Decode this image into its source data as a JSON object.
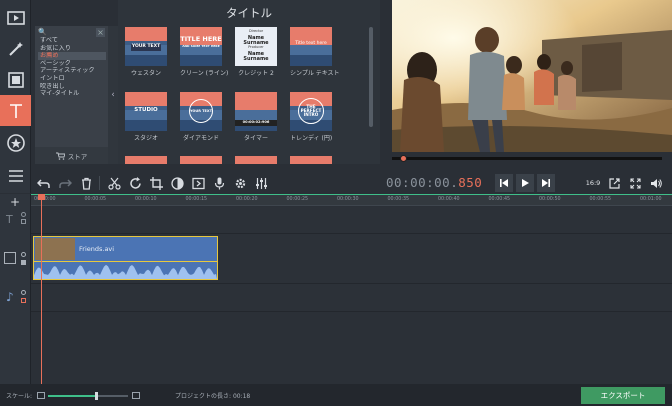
{
  "app": {
    "panel_title": "タイトル"
  },
  "categories": {
    "close_glyph": "×",
    "search_glyph": "🔍",
    "items": [
      "すべて",
      "お気に入り",
      "お薦め",
      "ベーシック",
      "アーティスティック",
      "イントロ",
      "吹き出し",
      "マイ-タイトル"
    ],
    "selected_index": 2,
    "store_label": "ストア"
  },
  "tiles": [
    {
      "name": "ウェスタン",
      "text": "YOUR TEXT",
      "style": "badge"
    },
    {
      "name": "クリーン (ライン)",
      "text": "TITLE HERE",
      "sub": "AND SOME TEXT HERE",
      "style": "clean"
    },
    {
      "name": "クレジット 2",
      "text": "Name Surname",
      "sub1": "Director",
      "sub2": "Producer",
      "text2": "Name Surname",
      "style": "credits"
    },
    {
      "name": "シンプル テキスト",
      "text": "Title text here",
      "style": "simple"
    },
    {
      "name": "スタジオ",
      "text": "STUDIO",
      "style": "studio"
    },
    {
      "name": "ダイアモンド",
      "text": "YOUR TEXT",
      "style": "diamond"
    },
    {
      "name": "タイマー",
      "text": "00:00:02:906",
      "style": "timer"
    },
    {
      "name": "トレンディ (円)",
      "text": "THE PERFECT INTRO",
      "style": "circle"
    }
  ],
  "player": {
    "timecode_main": "00:00:00.",
    "timecode_ms": "850",
    "aspect_label": "16:9",
    "progress": 0.03
  },
  "ruler": {
    "ticks": [
      "00:00:00",
      "00:00:05",
      "00:00:10",
      "00:00:15",
      "00:00:20",
      "00:00:25",
      "00:00:30",
      "00:00:35",
      "00:00:40",
      "00:00:45",
      "00:00:50",
      "00:00:55",
      "00:01:00"
    ]
  },
  "clip": {
    "label": "Friends.avi"
  },
  "status": {
    "scale_label": "スケール:",
    "project_length_label": "プロジェクトの長さ:",
    "project_length_value": "00:18",
    "zoom_level": 0.6,
    "export_label": "エクスポート"
  },
  "colors": {
    "accent": "#e8705a",
    "export": "#3f9a62",
    "clip": "#4b74b4",
    "clip_border": "#e7c83f"
  }
}
